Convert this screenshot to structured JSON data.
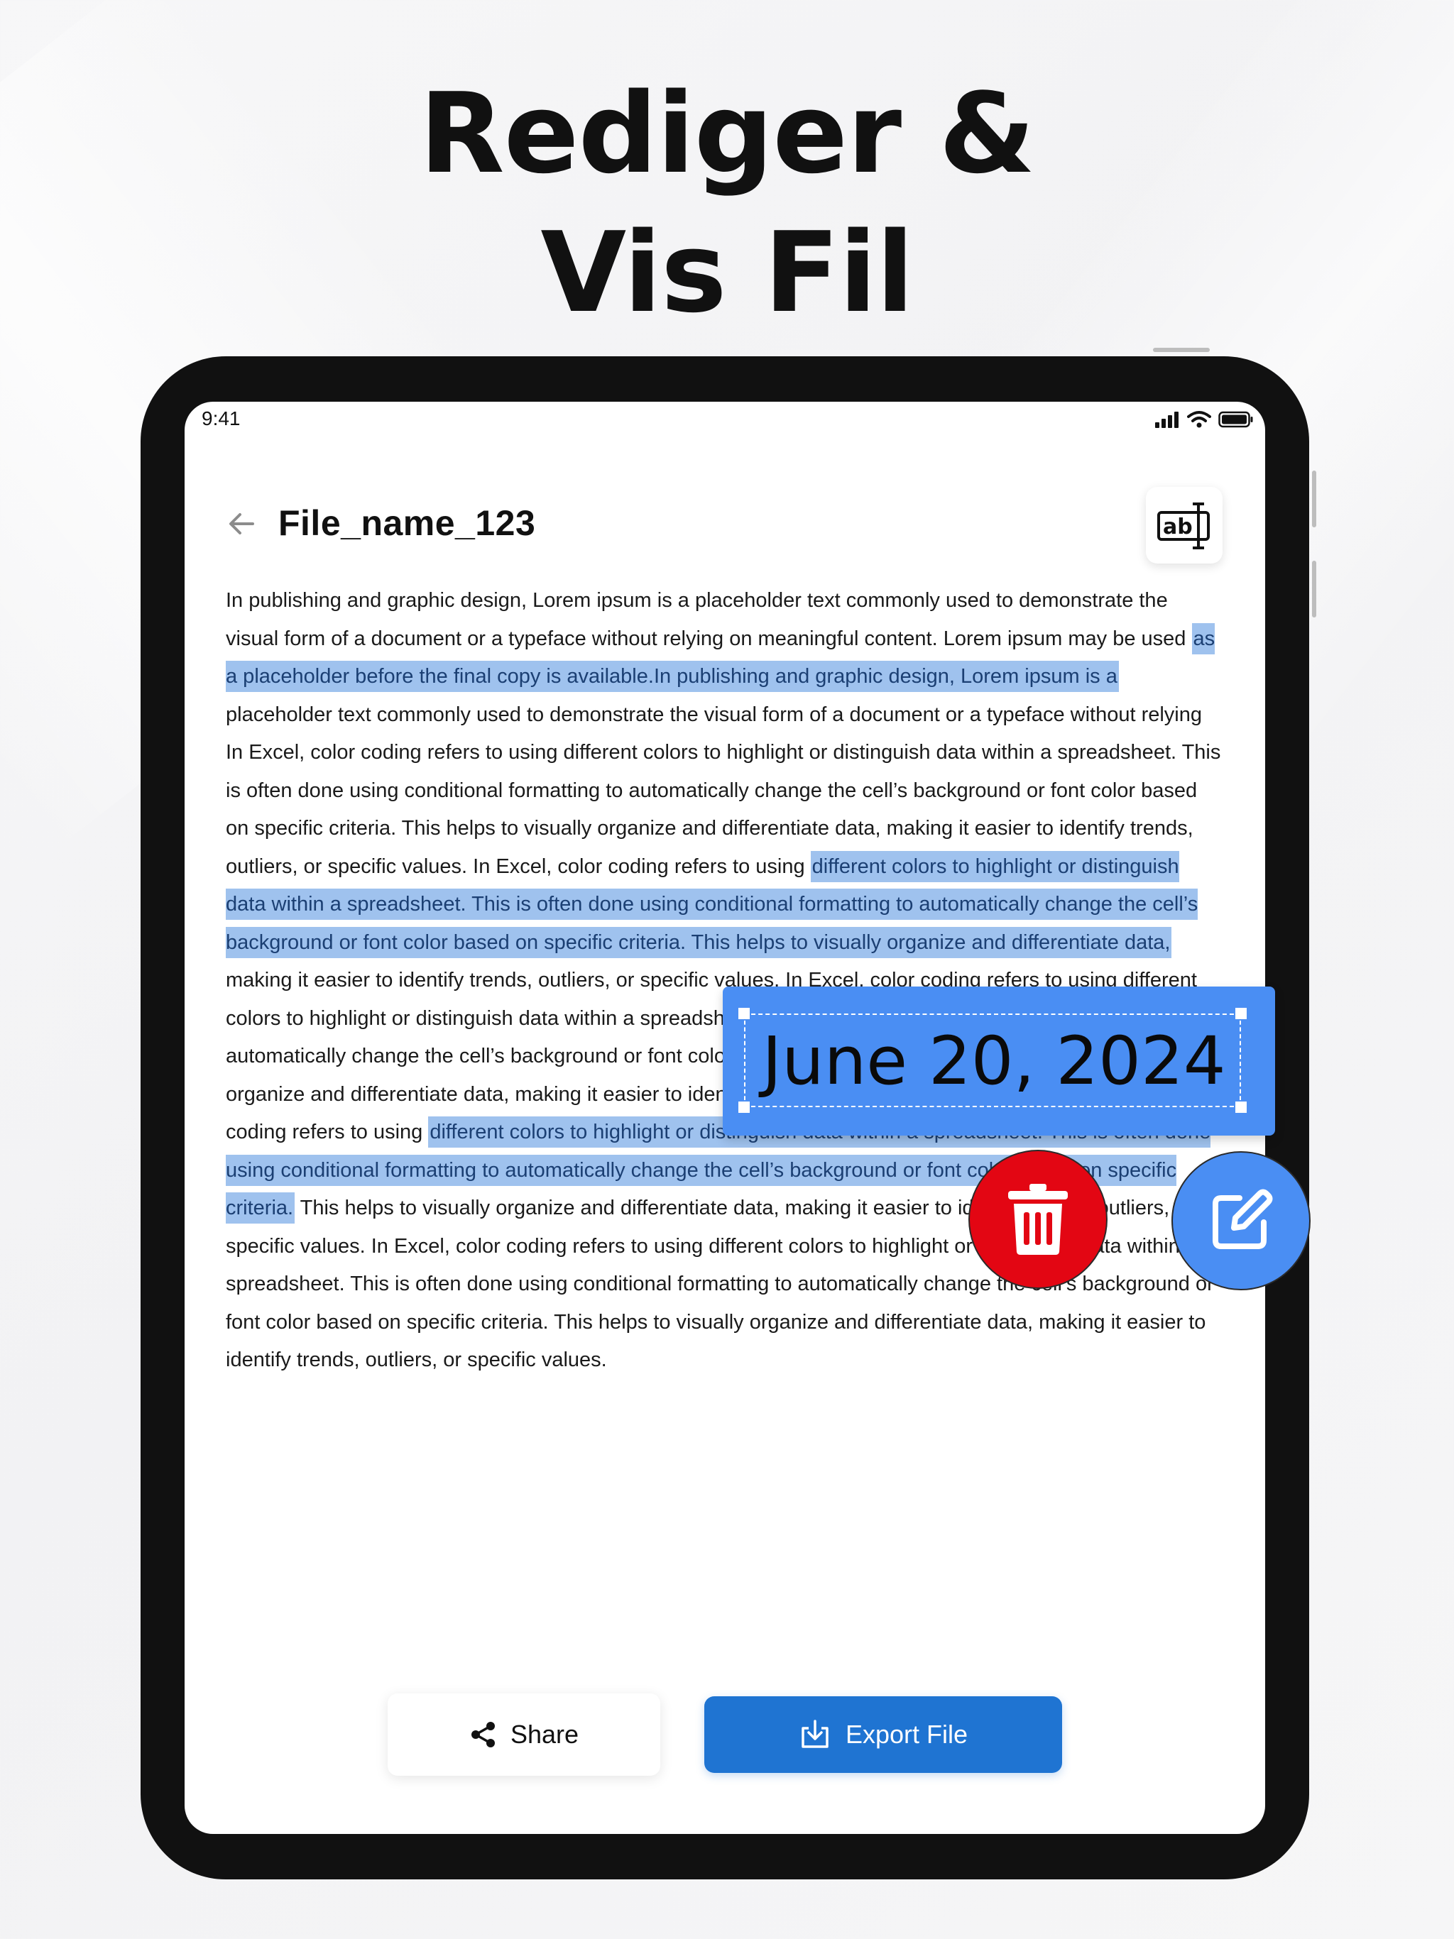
{
  "headline": {
    "line1": "Rediger &",
    "line2": "Vis Fil"
  },
  "status_bar": {
    "time": "9:41",
    "icons": [
      "signal-icon",
      "wifi-icon",
      "battery-icon"
    ]
  },
  "header": {
    "back_icon": "arrow-left-icon",
    "title": "File_name_123",
    "action_icon": "text-edit-ab-icon"
  },
  "document": {
    "p1": "In publishing and graphic design, Lorem ipsum is a placeholder text commonly used to demonstrate the visual form of a document or a typeface without relying on meaningful content. Lorem ipsum may be used ",
    "h1": "as a placeholder before the final copy is available.In publishing and graphic design, Lorem ipsum is a",
    "p2": " placeholder text commonly used to demonstrate the visual form of a document or a typeface without relying  In Excel, color coding refers to using different colors to highlight or distinguish data within a spreadsheet. This is often done using conditional formatting to automatically change the cell’s background or font color based on specific criteria. This helps to visually organize and differentiate data, making it easier to identify trends, outliers, or specific values. In Excel, color coding refers to using ",
    "h2": "different colors to highlight or distinguish data within a spreadsheet. This is often done using conditional formatting to automatically change the cell’s background or font color based on specific criteria. This helps to visually organize and differentiate data,",
    "p3": " making it easier to identify trends, outliers, or specific values. In Excel, color coding refers to using different colors to highlight or distinguish data within a spreadsheet. This is often done using conditional formatting to automatically change the cell’s background or font color based on specific criteria. This helps to visually organize and differentiate data, making it easier to identify trends, outliers, or specific values. In Excel, color coding refers to using ",
    "h3": "different colors to highlight or distinguish data within a spreadsheet. This is often done using conditional formatting to automatically change the cell’s background or font color based on specific criteria.",
    "p4": " This helps to visually organize and differentiate data, making it easier to identify trends, outliers, or specific values. In Excel, color coding refers to using different colors to highlight or distinguish data within a spreadsheet. This is often done using conditional formatting to automatically change the cell’s background or font color based on specific criteria. This helps to visually organize and differentiate data, making it easier to identify trends, outliers, or specific values."
  },
  "overlay": {
    "date_text": "June 20, 2024",
    "delete_icon": "trash-icon",
    "edit_icon": "edit-pencil-icon"
  },
  "actions": {
    "share_label": "Share",
    "share_icon": "share-icon",
    "export_label": "Export File",
    "export_icon": "export-download-icon"
  },
  "colors": {
    "highlight": "#9fc2ee",
    "accent_blue": "#1f74d2",
    "overlay_blue": "#4a8ef3",
    "delete_red": "#e30613"
  }
}
